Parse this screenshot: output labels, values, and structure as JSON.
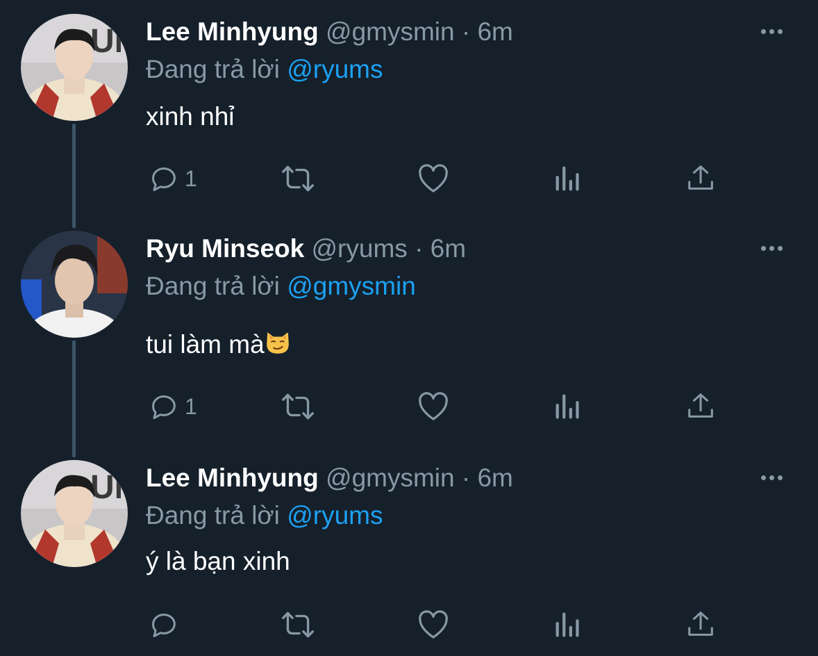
{
  "colors": {
    "background": "#15202b",
    "text_primary": "#ffffff",
    "text_secondary": "#8899a6",
    "mention": "#1da1f2",
    "thread_line": "#3d5466"
  },
  "tweets": [
    {
      "name": "Lee Minhyung",
      "handle": "@gmysmin",
      "dot": "·",
      "time": "6m",
      "reply_prefix": "Đang trả lời",
      "reply_to": "@ryums",
      "text": "xinh nhỉ",
      "reply_count": "1",
      "avatar_icon": "user-avatar"
    },
    {
      "name": "Ryu Minseok",
      "handle": "@ryums",
      "dot": "·",
      "time": "6m",
      "reply_prefix": "Đang trả lời",
      "reply_to": "@gmysmin",
      "text": "tui làm mà",
      "emoji": "smirking-cat-emoji",
      "reply_count": "1",
      "avatar_icon": "user-avatar"
    },
    {
      "name": "Lee Minhyung",
      "handle": "@gmysmin",
      "dot": "·",
      "time": "6m",
      "reply_prefix": "Đang trả lời",
      "reply_to": "@ryums",
      "text": "ý là bạn xinh",
      "reply_count": "",
      "avatar_icon": "user-avatar"
    }
  ],
  "icons": [
    "reply-icon",
    "retweet-icon",
    "like-icon",
    "analytics-icon",
    "share-icon",
    "more-options-icon"
  ]
}
